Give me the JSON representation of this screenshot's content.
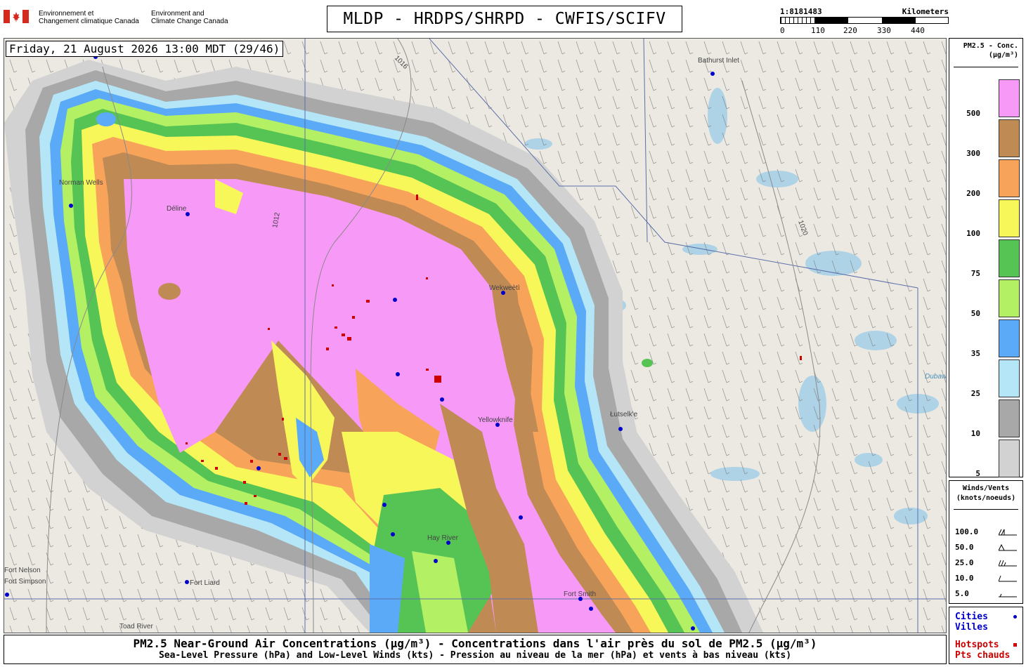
{
  "header": {
    "agency_fr": [
      "Environnement et",
      "Changement climatique Canada"
    ],
    "agency_en": [
      "Environment and",
      "Climate Change Canada"
    ],
    "title": "MLDP - HRDPS/SHRPD - CWFIS/SCIFV",
    "scale": {
      "ratio": "1:8181483",
      "units": "Kilometers",
      "ticks": [
        "0",
        "110",
        "220",
        "330",
        "440"
      ]
    }
  },
  "map": {
    "datetime": "Friday, 21 August 2026 13:00 MDT (29/46)",
    "cities": [
      "Bathurst Inlet",
      "Norman Wells",
      "Déline",
      "Wekweètì",
      "Yellowknife",
      "Łutselk'e",
      "Fort Smith",
      "Fort Liard",
      "Toad River",
      "Fort Simpson",
      "Hay River",
      "Fort Nelson"
    ],
    "isobars": [
      "1016",
      "1012",
      "1020"
    ],
    "lake_labels": [
      "Dubawnt Lake"
    ]
  },
  "legend": {
    "title": [
      "PM2.5 - Conc.",
      "(µg/m³)"
    ],
    "bins": [
      {
        "label": "500",
        "color": "#f799f7"
      },
      {
        "label": "300",
        "color": "#c08a55"
      },
      {
        "label": "200",
        "color": "#f7a45a"
      },
      {
        "label": "100",
        "color": "#f7f75a"
      },
      {
        "label": "75",
        "color": "#55c455"
      },
      {
        "label": "50",
        "color": "#b4f064"
      },
      {
        "label": "35",
        "color": "#5aaaf7"
      },
      {
        "label": "25",
        "color": "#b4e6f7"
      },
      {
        "label": "10",
        "color": "#a8a8a8"
      },
      {
        "label": "5",
        "color": "#d2d2d2"
      }
    ]
  },
  "winds": {
    "title": [
      "Winds/Vents",
      "(knots/noeuds)"
    ],
    "rows": [
      "100.0",
      "50.0",
      "25.0",
      "10.0",
      "5.0"
    ]
  },
  "markers": {
    "cities": [
      "Cities",
      "Villes"
    ],
    "city_color": "#0000cc",
    "hotspots": [
      "Hotspots",
      "Pts chauds"
    ],
    "hotspot_color": "#cc0000"
  },
  "footer": {
    "line1": "PM2.5 Near-Ground Air Concentrations (µg/m³) - Concentrations dans l'air près du sol de PM2.5 (µg/m³)",
    "line2": "Sea-Level Pressure (hPa) and Low-Level Winds (kts) - Pression au niveau de la mer (hPa) et vents à bas niveau (kts)"
  }
}
